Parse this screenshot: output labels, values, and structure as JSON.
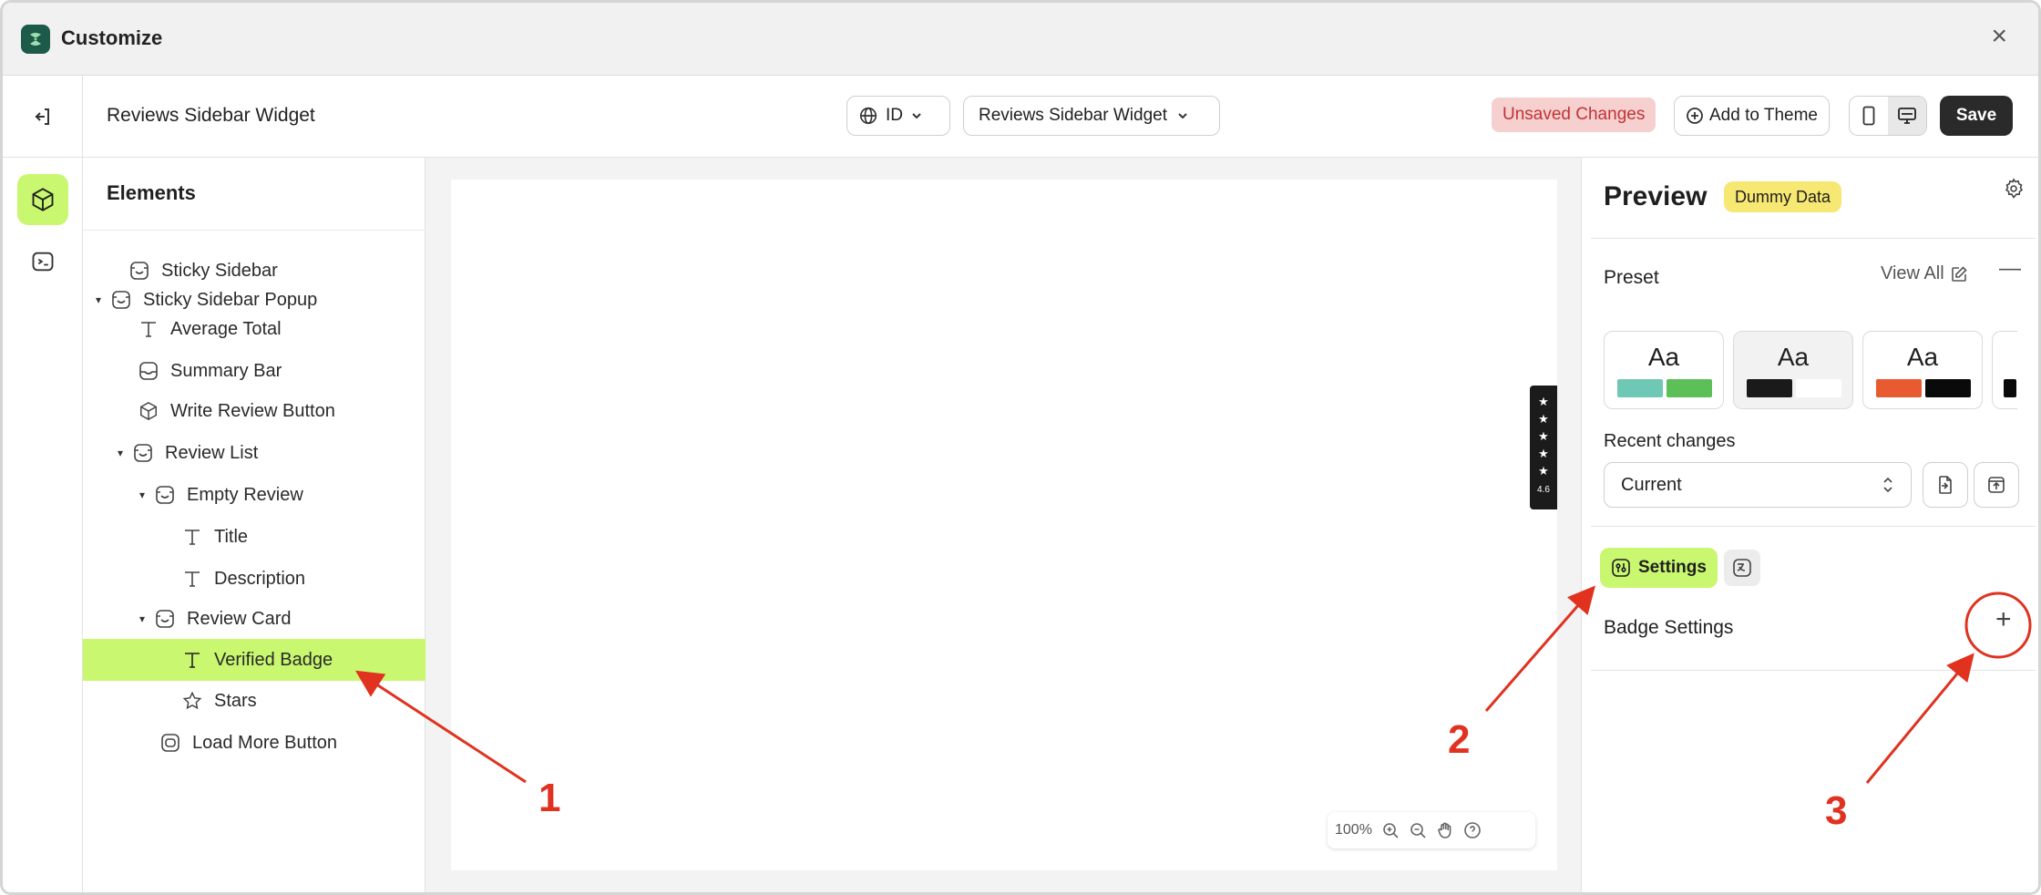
{
  "window": {
    "title": "Customize",
    "close_label": "×"
  },
  "toolbar": {
    "page_title": "Reviews Sidebar Widget",
    "language": "ID",
    "widget_select": "Reviews Sidebar Widget",
    "unsaved": "Unsaved Changes",
    "add_to_theme": "Add to Theme",
    "save": "Save"
  },
  "elements_panel": {
    "heading": "Elements",
    "items": [
      {
        "label": "Sticky Sidebar",
        "icon": "section-icon"
      },
      {
        "label": "Sticky Sidebar Popup",
        "icon": "section-icon",
        "expanded": true
      },
      {
        "label": "Average Total",
        "icon": "text-icon"
      },
      {
        "label": "Summary Bar",
        "icon": "section-icon"
      },
      {
        "label": "Write Review Button",
        "icon": "cube-icon"
      },
      {
        "label": "Review List",
        "icon": "section-icon",
        "expanded": true
      },
      {
        "label": "Empty Review",
        "icon": "section-icon",
        "expanded": true
      },
      {
        "label": "Title",
        "icon": "text-icon"
      },
      {
        "label": "Description",
        "icon": "text-icon"
      },
      {
        "label": "Review Card",
        "icon": "section-icon",
        "expanded": true
      },
      {
        "label": "Verified Badge",
        "icon": "text-icon",
        "selected": true
      },
      {
        "label": "Stars",
        "icon": "star-icon"
      },
      {
        "label": "Load More Button",
        "icon": "button-icon"
      }
    ]
  },
  "canvas": {
    "reviews_tab_stars": "★★★★★",
    "reviews_tab_rating": "4.6",
    "zoom": "100%"
  },
  "preview_panel": {
    "title": "Preview",
    "badge": "Dummy Data",
    "preset_label": "Preset",
    "view_all": "View All",
    "presets": [
      {
        "label": "Aa",
        "colors": [
          "#6fc7b6",
          "#5cbf58"
        ]
      },
      {
        "label": "Aa",
        "colors": [
          "#1a1a1a",
          "#ffffff"
        ]
      },
      {
        "label": "Aa",
        "colors": [
          "#e85a30",
          "#0a0a0a"
        ]
      }
    ],
    "recent_changes_label": "Recent changes",
    "recent_changes_value": "Current",
    "settings_tab": "Settings",
    "badge_settings": "Badge Settings"
  },
  "annotations": {
    "one": "1",
    "two": "2",
    "three": "3"
  },
  "colors": {
    "accent": "#c9f76f",
    "annotation": "#e0321f",
    "unsaved_bg": "#f6cfcf",
    "dummy_bg": "#f7e773"
  }
}
